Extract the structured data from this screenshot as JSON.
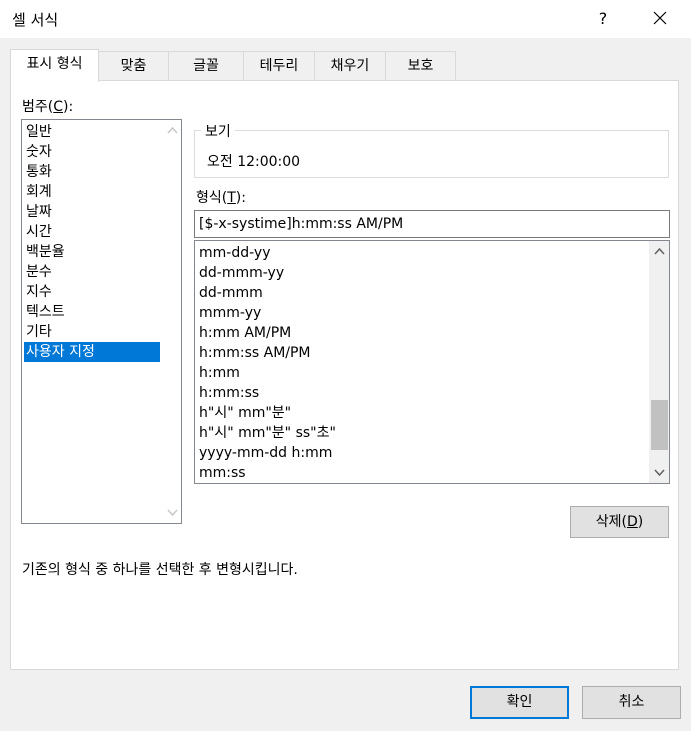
{
  "dialog": {
    "title": "셀 서식",
    "help_label": "?"
  },
  "tabs": [
    {
      "label": "표시 형식",
      "active": true
    },
    {
      "label": "맞춤"
    },
    {
      "label": "글꼴"
    },
    {
      "label": "테두리"
    },
    {
      "label": "채우기"
    },
    {
      "label": "보호"
    }
  ],
  "category": {
    "label_prefix": "범주(",
    "label_key": "C",
    "label_suffix": "):",
    "items": [
      "일반",
      "숫자",
      "통화",
      "회계",
      "날짜",
      "시간",
      "백분율",
      "분수",
      "지수",
      "텍스트",
      "기타",
      "사용자 지정"
    ],
    "selected": "사용자 지정"
  },
  "sample": {
    "legend": "보기",
    "value": "오전 12:00:00"
  },
  "format": {
    "label_prefix": "형식(",
    "label_key": "T",
    "label_suffix": "):",
    "input_value": "[$-x-systime]h:mm:ss AM/PM",
    "items": [
      "mm-dd-yy",
      "dd-mmm-yy",
      "dd-mmm",
      "mmm-yy",
      "h:mm AM/PM",
      "h:mm:ss AM/PM",
      "h:mm",
      "h:mm:ss",
      "h\"시\" mm\"분\"",
      "h\"시\" mm\"분\" ss\"초\"",
      "yyyy-mm-dd h:mm",
      "mm:ss"
    ]
  },
  "delete_button": {
    "label_prefix": "삭제(",
    "label_key": "D",
    "label_suffix": ")"
  },
  "hint_text": "기존의 형식 중 하나를 선택한 후 변형시킵니다.",
  "buttons": {
    "ok": "확인",
    "cancel": "취소"
  },
  "colors": {
    "selection": "#0078d7",
    "default_button_border": "#0078d7"
  }
}
